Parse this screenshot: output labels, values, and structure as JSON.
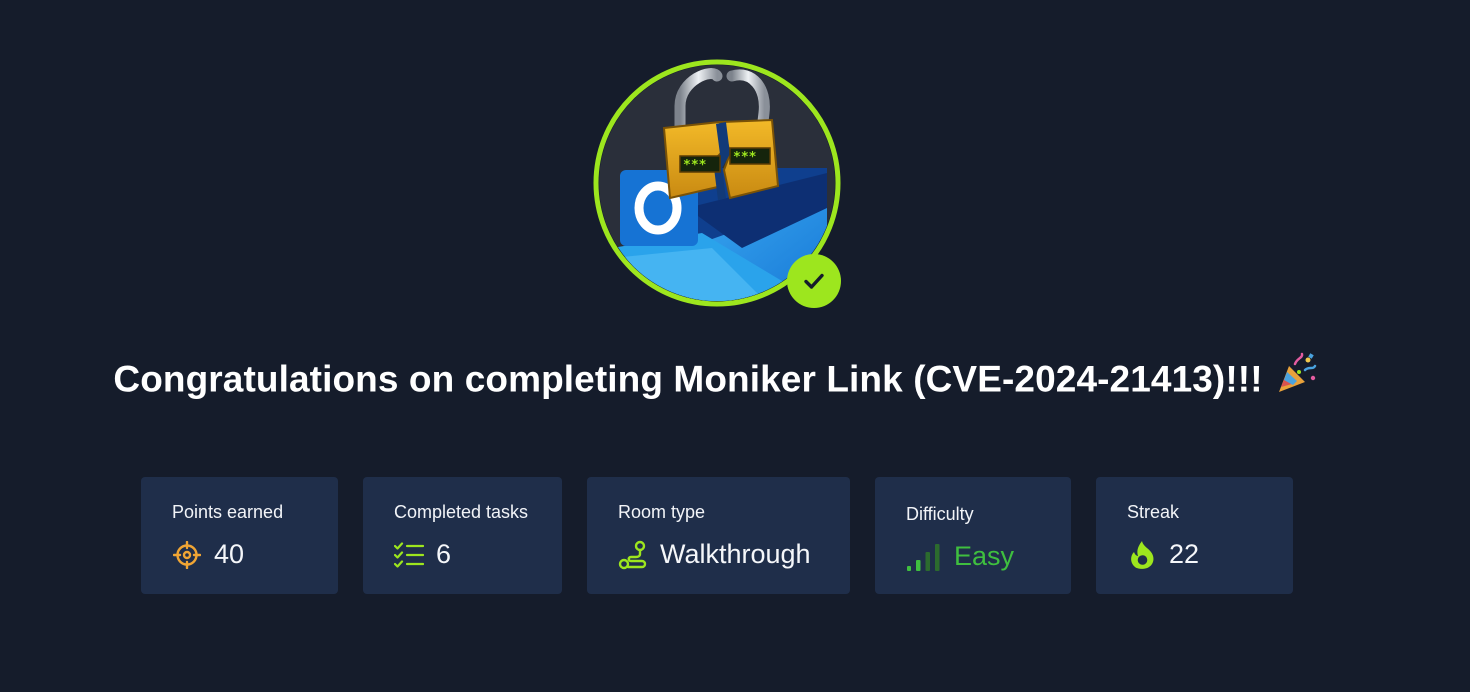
{
  "badge": {
    "icon": "moniker-link-room-badge",
    "status_icon": "checkmark-icon",
    "ring_color": "#9de61e"
  },
  "title": {
    "text": "Congratulations on completing Moniker Link (CVE-2024-21413)!!!",
    "emoji_icon": "party-popper-icon"
  },
  "stats": [
    {
      "label": "Points earned",
      "value": "40",
      "icon": "target-icon"
    },
    {
      "label": "Completed tasks",
      "value": "6",
      "icon": "task-list-icon"
    },
    {
      "label": "Room type",
      "value": "Walkthrough",
      "icon": "route-icon"
    },
    {
      "label": "Difficulty",
      "value": "Easy",
      "icon": "signal-bars-icon",
      "color": "#3fbf3f"
    },
    {
      "label": "Streak",
      "value": "22",
      "icon": "flame-icon"
    }
  ],
  "colors": {
    "background": "#151c2b",
    "card": "#1f2e4a",
    "accent_green": "#9de61e",
    "points_orange": "#f0a534"
  }
}
